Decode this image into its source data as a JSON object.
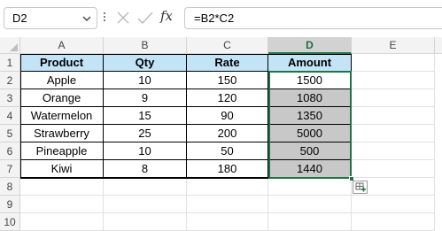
{
  "formula_bar": {
    "name_box": "D2",
    "fx_label": "fx",
    "formula": "=B2*C2"
  },
  "columns": [
    "A",
    "B",
    "C",
    "D",
    "E"
  ],
  "rows": [
    "1",
    "2",
    "3",
    "4",
    "5",
    "6",
    "7",
    "8",
    "9",
    "10"
  ],
  "table": {
    "headers": [
      "Product",
      "Qty",
      "Rate",
      "Amount"
    ],
    "rows": [
      [
        "Apple",
        "10",
        "150",
        "1500"
      ],
      [
        "Orange",
        "9",
        "120",
        "1080"
      ],
      [
        "Watermelon",
        "15",
        "90",
        "1350"
      ],
      [
        "Strawberry",
        "25",
        "200",
        "5000"
      ],
      [
        "Pineapple",
        "10",
        "50",
        "500"
      ],
      [
        "Kiwi",
        "8",
        "180",
        "1440"
      ]
    ]
  },
  "selection": {
    "active_cell": "D2",
    "range": "D2:D7"
  },
  "colors": {
    "header_fill": "#c3e3f7",
    "calculated_fill": "#c8c8c8",
    "selection_accent": "#217346"
  },
  "icons": {
    "name_box_dropdown": "chevron-down-icon",
    "more_options": "more-options-icon",
    "cancel": "cancel-icon",
    "enter": "enter-icon",
    "quick_analysis": "quick-analysis-icon"
  }
}
